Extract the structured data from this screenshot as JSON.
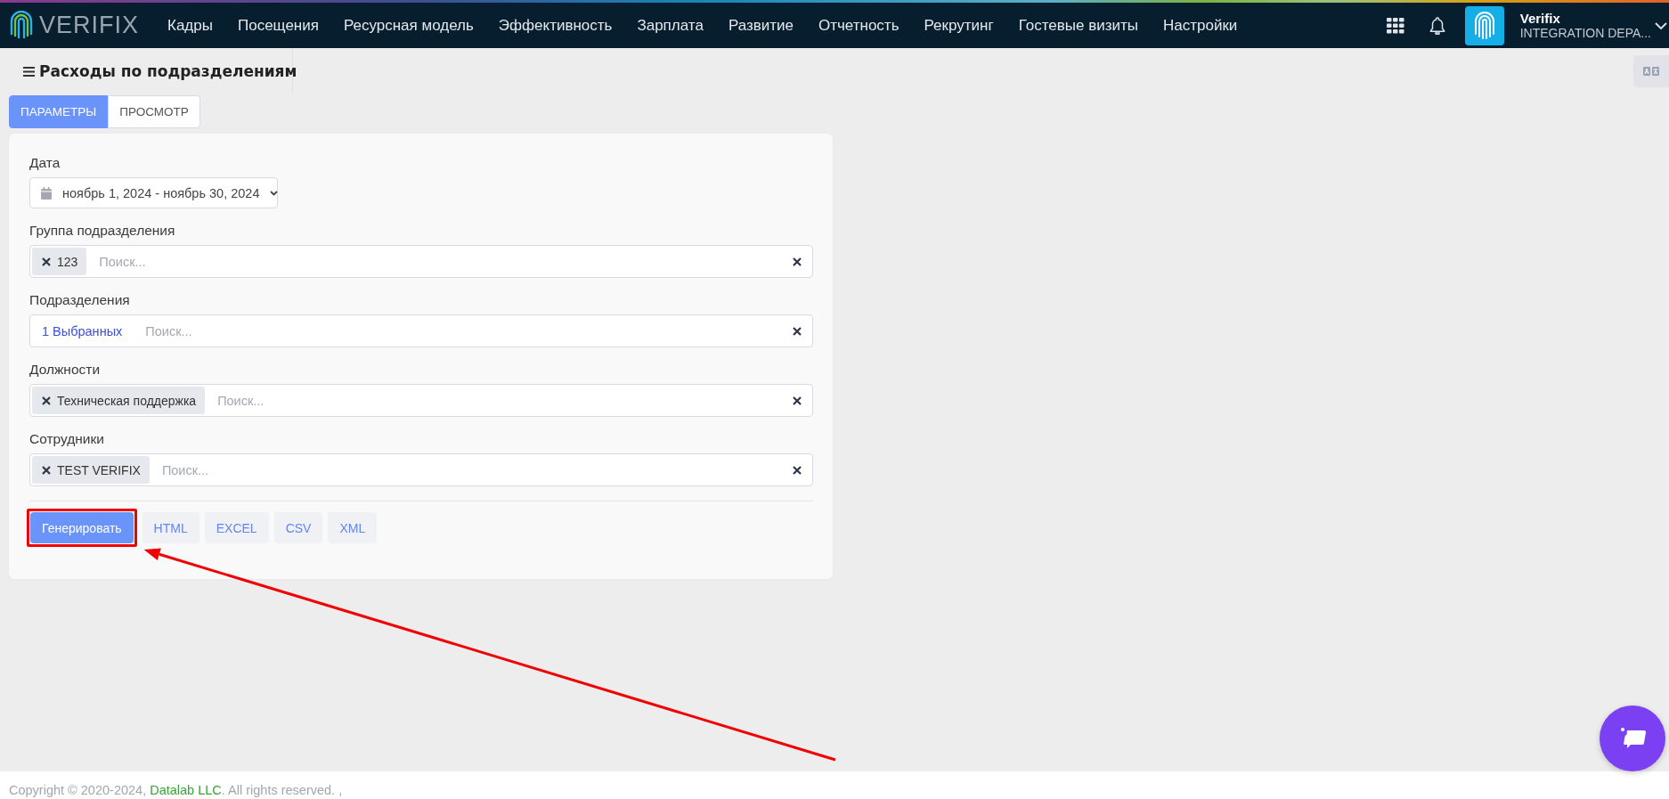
{
  "navbar": {
    "logo_text": "VERIFIX",
    "menu": [
      {
        "label": "Кадры"
      },
      {
        "label": "Посещения"
      },
      {
        "label": "Ресурсная модель"
      },
      {
        "label": "Эффективность"
      },
      {
        "label": "Зарплата"
      },
      {
        "label": "Развитие"
      },
      {
        "label": "Отчетность"
      },
      {
        "label": "Рекрутинг"
      },
      {
        "label": "Гостевые визиты"
      },
      {
        "label": "Настройки"
      }
    ],
    "user": {
      "name": "Verifix",
      "org": "INTEGRATION DEPA..."
    }
  },
  "page_title": "Расходы по подразделениям",
  "tabs": [
    {
      "label": "ПАРАМЕТРЫ",
      "selected": true
    },
    {
      "label": "ПРОСМОТР",
      "selected": false
    }
  ],
  "form": {
    "fields": [
      {
        "kind": "date",
        "label": "Дата",
        "value": "ноябрь 1, 2024 - ноябрь 30, 2024"
      },
      {
        "kind": "tags",
        "label": "Группа подразделения",
        "tags": [
          "123"
        ],
        "placeholder": "Поиск..."
      },
      {
        "kind": "count",
        "label": "Подразделения",
        "count_text": "1 Выбранных",
        "placeholder": "Поиск..."
      },
      {
        "kind": "tags",
        "label": "Должности",
        "tags": [
          "Техническая поддержка"
        ],
        "placeholder": "Поиск..."
      },
      {
        "kind": "tags",
        "label": "Сотрудники",
        "tags": [
          "TEST VERIFIX"
        ],
        "placeholder": "Поиск..."
      }
    ],
    "buttons": [
      {
        "label": "Генерировать",
        "kind": "primary"
      },
      {
        "label": "HTML",
        "kind": "format"
      },
      {
        "label": "EXCEL",
        "kind": "format"
      },
      {
        "label": "CSV",
        "kind": "format"
      },
      {
        "label": "XML",
        "kind": "format"
      }
    ]
  },
  "footer": {
    "text_before": "Copyright © 2020-2024, ",
    "link": "Datalab LLC",
    "text_after": ". All rights reserved. ,"
  }
}
